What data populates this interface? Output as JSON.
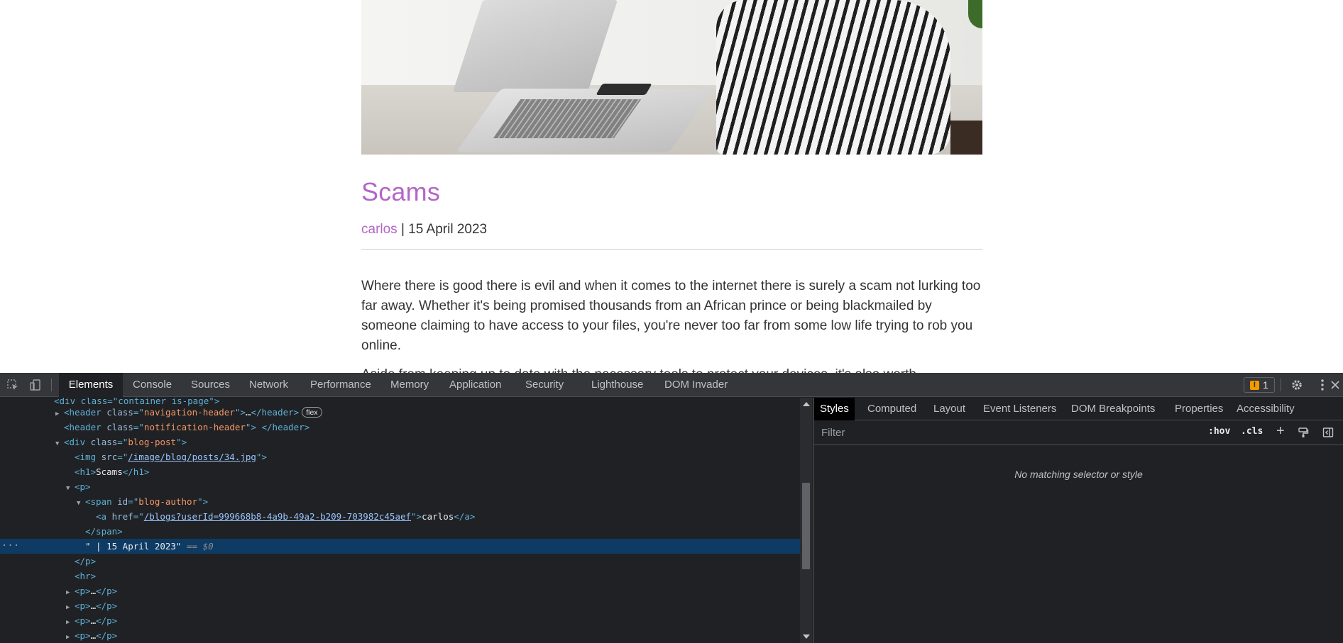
{
  "page": {
    "title": "Scams",
    "author": "carlos",
    "date_sep": "| 15 April 2023",
    "paragraph1": "Where there is good there is evil and when it comes to the internet there is surely a scam not lurking too far away. Whether it's being promised thousands from an African prince or being blackmailed by someone claiming to have access to your files, you're never too far from some low life trying to rob you online.",
    "paragraph2_partial": "Aside from keeping up to date with the necessary tools to protect your devices, it's also worth"
  },
  "devtools": {
    "tabs": [
      "Elements",
      "Console",
      "Sources",
      "Network",
      "Performance",
      "Memory",
      "Application",
      "Security",
      "Lighthouse",
      "DOM Invader"
    ],
    "active_tab": "Elements",
    "issues_count": "1",
    "dom": {
      "line0": "<div class=\"container is-page\">",
      "header1_tag": "header",
      "header1_class": "navigation-header",
      "header1_ellipsis": "…",
      "flex_badge": "flex",
      "header2_class": "notification-header",
      "blogpost_class": "blog-post",
      "img_src": "/image/blog/posts/34.jpg",
      "h1_text": "Scams",
      "span_id": "blog-author",
      "a_href": "/blogs?userId=999668b8-4a9b-49a2-b209-703982c45aef",
      "a_text": "carlos",
      "selected_text": "\" | 15 April 2023\"",
      "selected_marker": "== $0",
      "collapsed_p": "…"
    },
    "styles": {
      "tabs": [
        "Styles",
        "Computed",
        "Layout",
        "Event Listeners",
        "DOM Breakpoints",
        "Properties",
        "Accessibility"
      ],
      "active_tab": "Styles",
      "filter_placeholder": "Filter",
      "hov_label": ":hov",
      "cls_label": ".cls",
      "plus_label": "+",
      "empty_message": "No matching selector or style"
    }
  },
  "colors": {
    "accent_purple": "#b366c7",
    "devtools_bg": "#202124",
    "selection": "#0e3b63"
  }
}
